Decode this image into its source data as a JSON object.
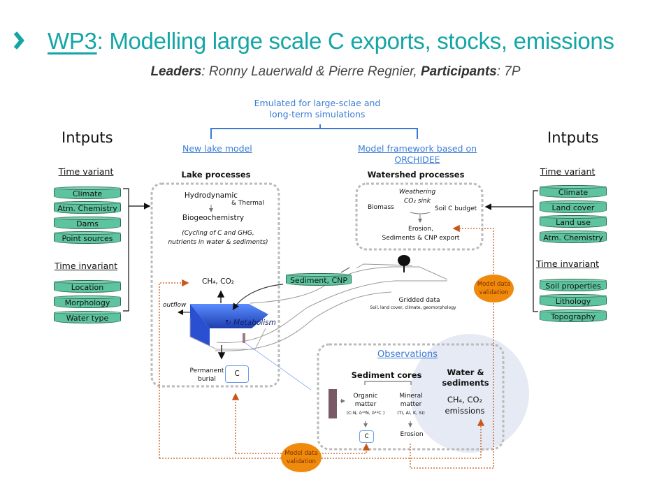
{
  "header": {
    "title_prefix": "WP3",
    "title_rest": ": Modelling large scale C exports, stocks, emissions",
    "leaders_label": "Leaders",
    "leaders_value": ": Ronny Lauerwald & Pierre Regnier, ",
    "participants_label": "Participants",
    "participants_value": ": 7P",
    "accent_color": "#15a5a5"
  },
  "diagram": {
    "emulated": [
      "Emulated for large-sclae and",
      "long-term simulations"
    ],
    "new_lake_model": "New lake model",
    "model_framework": [
      "Model framework based on",
      "ORCHIDEE"
    ],
    "left_inputs": {
      "title": "Intputs",
      "time_variant_label": "Time variant",
      "time_variant": [
        "Climate",
        "Atm. Chemistry",
        "Dams",
        "Point sources"
      ],
      "time_invariant_label": "Time invariant",
      "time_invariant": [
        "Location",
        "Morphology",
        "Water type"
      ]
    },
    "right_inputs": {
      "title": "Intputs",
      "time_variant_label": "Time variant",
      "time_variant": [
        "Climate",
        "Land cover",
        "Land use",
        "Atm. Chemistry"
      ],
      "time_invariant_label": "Time invariant",
      "time_invariant": [
        "Soil properties",
        "Lithology",
        "Topography"
      ]
    },
    "lake": {
      "title": "Lake processes",
      "hydrodynamic": "Hydrodynamic",
      "thermal": "& Thermal",
      "biogeochemistry": "Biogeochemistry",
      "cycling": [
        "(Cycling of C and GHG,",
        "nutrients in water & sediments)"
      ],
      "gases": "CH₄, CO₂",
      "outflow": "outflow",
      "metabolism": "Metabolism",
      "burial": [
        "Permanent",
        "burial"
      ],
      "carbon": "C"
    },
    "watershed": {
      "title": "Watershed processes",
      "weathering": [
        "Weathering",
        "CO₂ sink"
      ],
      "biomass": "Biomass",
      "soil_c": "Soil C budget",
      "erosion": [
        "Erosion,",
        "Sediments & CNP export"
      ]
    },
    "sediment_cnp": "Sediment, CNP",
    "gridded": {
      "title": "Gridded data",
      "subtitle": "Soil, land cover, climate, geomorphology"
    },
    "validation": [
      "Model data",
      "validation"
    ],
    "observations": {
      "title": "Observations",
      "sediment_cores": "Sediment cores",
      "organic": [
        "Organic",
        "matter",
        "(C:N, δ¹⁵N, δ¹³C )"
      ],
      "mineral": [
        "Mineral",
        "matter",
        "(Ti, Al, K, Si)"
      ],
      "carbon": "C",
      "erosion": "Erosion",
      "water": [
        "Water &",
        "sediments"
      ],
      "emissions": [
        "CH₄, CO₂",
        "emissions"
      ]
    },
    "colors": {
      "cylinder": "#5ec4a0",
      "validation": "#f08a0c",
      "dotted_arrow": "#c8581a",
      "link": "#3a7bd5",
      "lake": "#3d6ef0"
    }
  }
}
